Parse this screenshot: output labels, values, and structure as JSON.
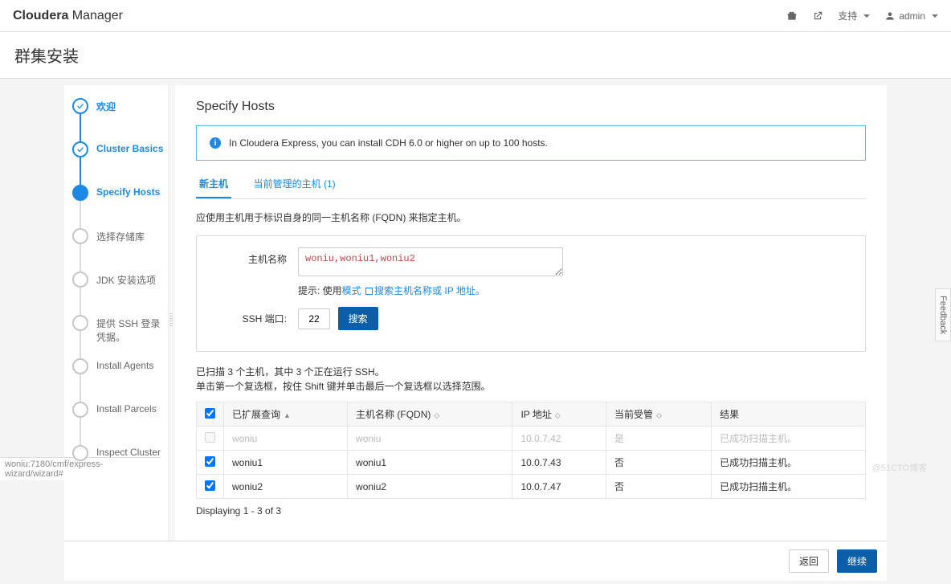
{
  "brand": {
    "first": "Cloudera",
    "second": "Manager"
  },
  "topnav": {
    "support": "支持",
    "user": "admin"
  },
  "page_title": "群集安装",
  "steps": [
    {
      "label": "欢迎",
      "state": "done"
    },
    {
      "label": "Cluster Basics",
      "state": "done"
    },
    {
      "label": "Specify Hosts",
      "state": "active"
    },
    {
      "label": "选择存储库",
      "state": "pending"
    },
    {
      "label": "JDK 安装选项",
      "state": "pending"
    },
    {
      "label": "提供 SSH 登录凭据。",
      "state": "pending"
    },
    {
      "label": "Install Agents",
      "state": "pending"
    },
    {
      "label": "Install Parcels",
      "state": "pending"
    },
    {
      "label": "Inspect Cluster",
      "state": "pending"
    }
  ],
  "section_title": "Specify Hosts",
  "info_banner": "In Cloudera Express, you can install CDH 6.0 or higher on up to 100 hosts.",
  "tabs": {
    "new": "新主机",
    "managed": "当前管理的主机 (1)"
  },
  "desc": "应使用主机用于标识自身的同一主机名称 (FQDN) 来指定主机。",
  "form": {
    "label_hostname": "主机名称",
    "hostname_value": "woniu,woniu1,woniu2",
    "hint_prefix": "提示: 使用",
    "hint_link1": "模式",
    "hint_mid": "搜索主机名称或 IP 地址。",
    "label_ssh": "SSH 端口:",
    "ssh_value": "22",
    "btn_search": "搜索"
  },
  "scan_info": {
    "line1": "已扫描 3 个主机，其中 3 个正在运行 SSH。",
    "line2": "单击第一个复选框，按住 Shift 键并单击最后一个复选框以选择范围。"
  },
  "table": {
    "headers": {
      "expand": "已扩展查询",
      "fqdn": "主机名称 (FQDN)",
      "ip": "IP 地址",
      "managed": "当前受管",
      "result": "结果"
    },
    "rows": [
      {
        "checked": false,
        "disabled": true,
        "name": "woniu",
        "fqdn": "woniu",
        "ip": "10.0.7.42",
        "managed": "是",
        "result": "已成功扫描主机。"
      },
      {
        "checked": true,
        "disabled": false,
        "name": "woniu1",
        "fqdn": "woniu1",
        "ip": "10.0.7.43",
        "managed": "否",
        "result": "已成功扫描主机。"
      },
      {
        "checked": true,
        "disabled": false,
        "name": "woniu2",
        "fqdn": "woniu2",
        "ip": "10.0.7.47",
        "managed": "否",
        "result": "已成功扫描主机。"
      }
    ],
    "display": "Displaying 1 - 3 of 3"
  },
  "footer": {
    "back": "返回",
    "next": "继续"
  },
  "status_url": "woniu:7180/cmf/express-wizard/wizard#",
  "feedback": "Feedback",
  "watermark": "@51CTO博客"
}
